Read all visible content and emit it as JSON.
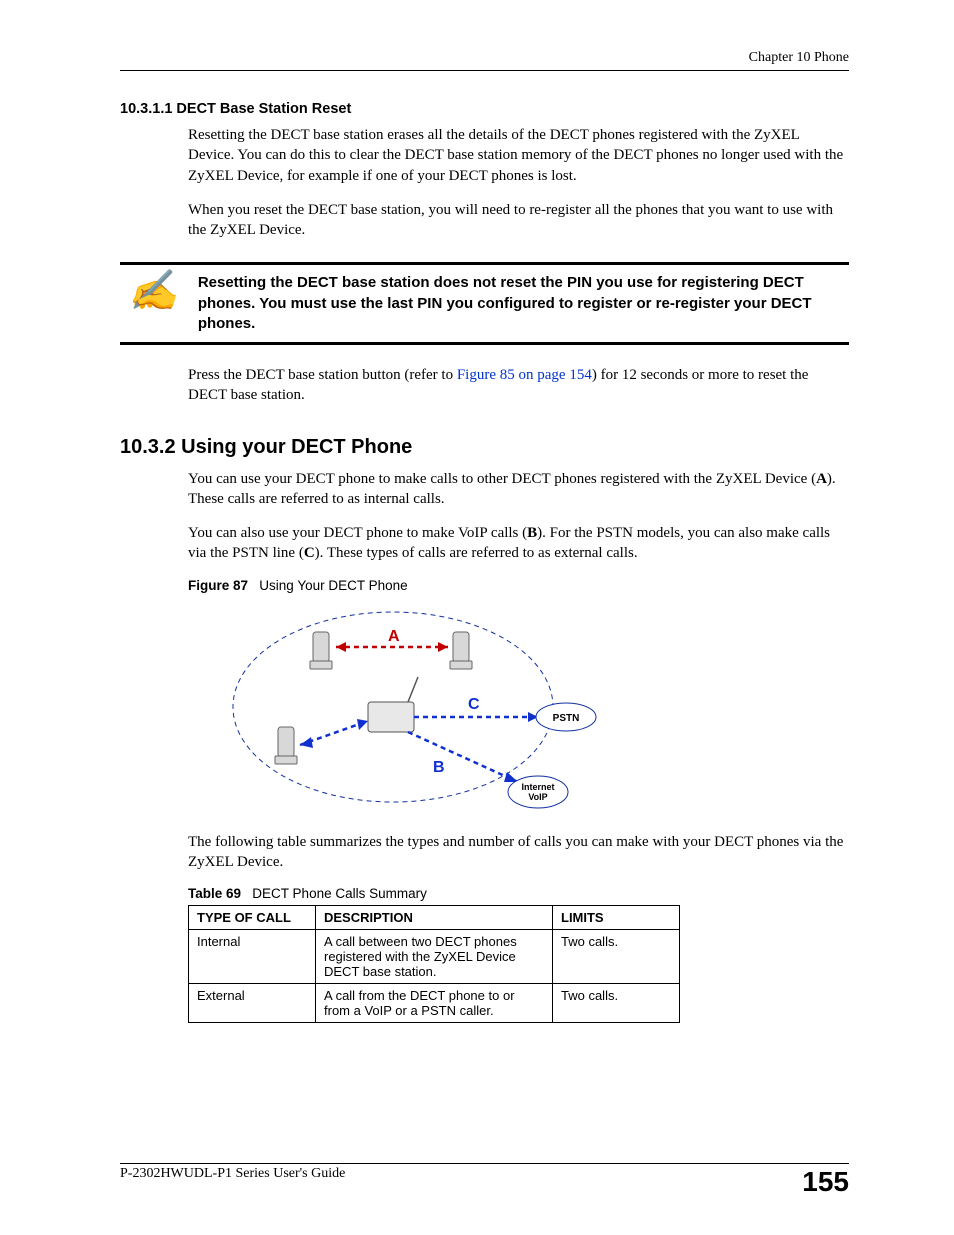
{
  "header": {
    "chapter": "Chapter 10 Phone"
  },
  "sec1": {
    "num_title": "10.3.1.1  DECT Base Station Reset",
    "p1": "Resetting the DECT base station erases all the details of the DECT phones registered with the ZyXEL Device. You can do this to clear the DECT base station memory of the DECT phones no longer used with the ZyXEL Device, for example if one of your DECT phones is lost.",
    "p2": "When you reset the DECT base station, you will need to re-register all the phones that you want to use with the ZyXEL Device."
  },
  "note": {
    "icon": "✍",
    "text": "Resetting the DECT base station does not reset the PIN you use for registering DECT phones. You must use the last PIN you configured to register or re-register your DECT phones."
  },
  "press": {
    "pre": "Press the DECT base station button (refer to ",
    "link": "Figure 85 on page 154",
    "post": ") for 12 seconds or more to reset the DECT base station."
  },
  "sec2": {
    "num_title": "10.3.2  Using your DECT Phone",
    "p1_a": "You can use your DECT phone to make calls to other DECT phones registered with the ZyXEL Device (",
    "p1_b": "A",
    "p1_c": "). These calls are referred to as internal calls.",
    "p2_a": "You can also use your DECT phone to make VoIP calls (",
    "p2_b": "B",
    "p2_c": "). For the PSTN models, you can also make calls via the PSTN line (",
    "p2_d": "C",
    "p2_e": "). These types of calls are referred to as external calls."
  },
  "figure": {
    "label": "Figure 87",
    "title": "Using Your DECT Phone",
    "A": "A",
    "B": "B",
    "C": "C",
    "pstn": "PSTN",
    "internet1": "Internet",
    "internet2": "VoIP"
  },
  "tablefollows": "The following table summarizes the types and number of calls you can make with your DECT phones via the ZyXEL Device.",
  "table": {
    "label": "Table 69",
    "title": "DECT Phone Calls Summary",
    "headers": [
      "TYPE OF CALL",
      "DESCRIPTION",
      "LIMITS"
    ],
    "rows": [
      {
        "c0": "Internal",
        "c1": "A call between two DECT phones registered with the ZyXEL Device DECT base station.",
        "c2": "Two calls."
      },
      {
        "c0": "External",
        "c1": "A call from the DECT phone to or from a VoIP or a PSTN caller.",
        "c2": "Two calls."
      }
    ]
  },
  "chart_data": [
    {
      "type": "table",
      "title": "DECT Phone Calls Summary",
      "columns": [
        "TYPE OF CALL",
        "DESCRIPTION",
        "LIMITS"
      ],
      "rows": [
        [
          "Internal",
          "A call between two DECT phones registered with the ZyXEL Device DECT base station.",
          "Two calls."
        ],
        [
          "External",
          "A call from the DECT phone to or from a VoIP or a PSTN caller.",
          "Two calls."
        ]
      ]
    }
  ],
  "footer": {
    "guide": "P-2302HWUDL-P1 Series User's Guide",
    "page": "155"
  }
}
